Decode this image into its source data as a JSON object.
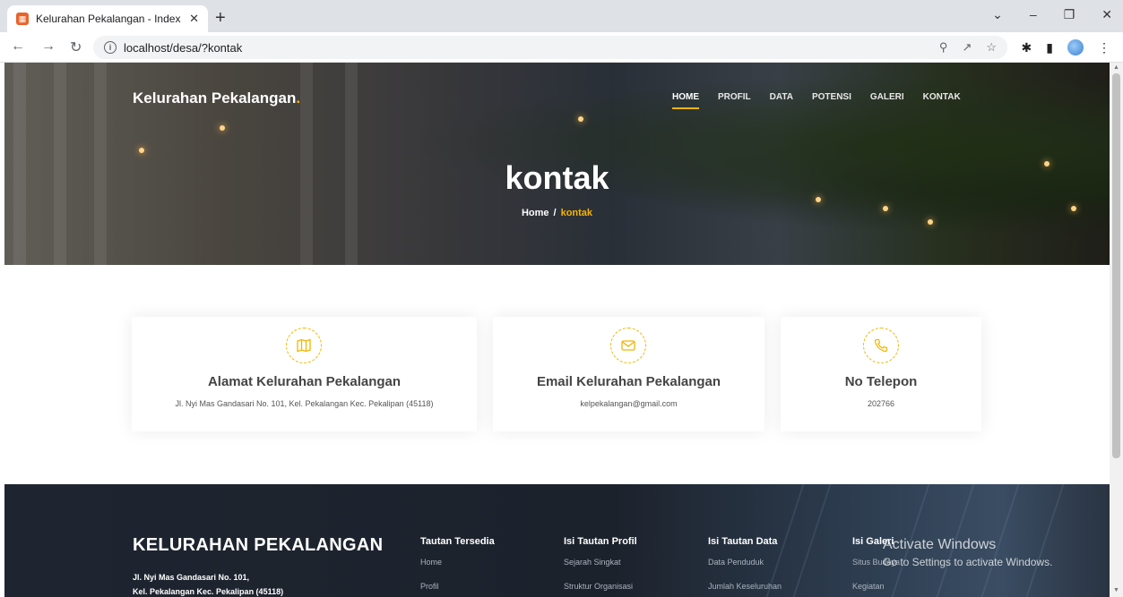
{
  "browser": {
    "tab_title": "Kelurahan Pekalangan - Index",
    "url": "localhost/desa/?kontak"
  },
  "header": {
    "brand": "Kelurahan Pekalangan",
    "brand_dot": ".",
    "nav": [
      "HOME",
      "PROFIL",
      "DATA",
      "POTENSI",
      "GALERI",
      "KONTAK"
    ],
    "active_nav": "HOME"
  },
  "hero": {
    "title": "kontak",
    "breadcrumb_home": "Home",
    "breadcrumb_sep": "/",
    "breadcrumb_current": "kontak"
  },
  "cards": [
    {
      "title": "Alamat Kelurahan Pekalangan",
      "text": "Jl. Nyi Mas Gandasari No. 101, Kel. Pekalangan Kec. Pekalipan (45118)",
      "icon": "map-icon"
    },
    {
      "title": "Email Kelurahan Pekalangan",
      "text": "kelpekalangan@gmail.com",
      "icon": "envelope-icon"
    },
    {
      "title": "No Telepon",
      "text": "202766",
      "icon": "phone-icon"
    }
  ],
  "footer": {
    "brand": "KELURAHAN PEKALANGAN",
    "address_line1": "Jl. Nyi Mas Gandasari No. 101,",
    "address_line2": "Kel. Pekalangan Kec. Pekalipan (45118)",
    "columns": [
      {
        "heading": "Tautan Tersedia",
        "links": [
          "Home",
          "Profil"
        ]
      },
      {
        "heading": "Isi Tautan Profil",
        "links": [
          "Sejarah Singkat",
          "Struktur Organisasi"
        ]
      },
      {
        "heading": "Isi Tautan Data",
        "links": [
          "Data Penduduk",
          "Jumlah Keseluruhan"
        ]
      },
      {
        "heading": "Isi Galeri",
        "links": [
          "Situs Budaya",
          "Kegiatan"
        ]
      }
    ]
  },
  "watermark": {
    "title": "Activate Windows",
    "subtitle": "Go to Settings to activate Windows."
  },
  "colors": {
    "accent": "#f5b400"
  }
}
